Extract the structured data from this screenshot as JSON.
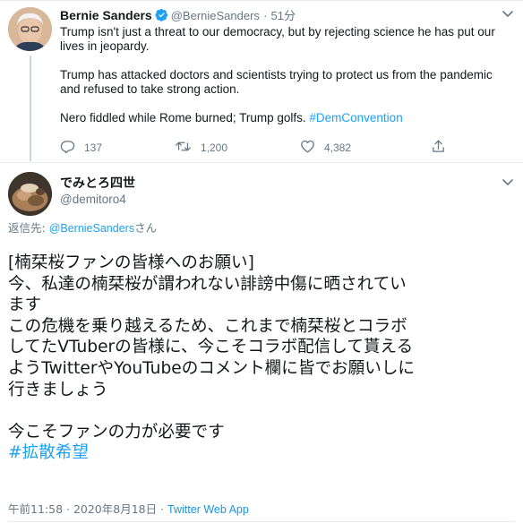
{
  "quoted": {
    "name": "Bernie Sanders",
    "handle": "@BernieSanders",
    "separator": "·",
    "time": "51分",
    "paragraphs": [
      "Trump isn't just a threat to our democracy, but by rejecting science he has put our lives in jeopardy.",
      "Trump has attacked doctors and scientists trying to protect us from the pandemic and refused to take strong action."
    ],
    "last_line_text": "Nero fiddled while Rome burned; Trump golfs. ",
    "hashtag": "#DemConvention",
    "replies": "137",
    "retweets": "1,200",
    "likes": "4,382"
  },
  "tweet": {
    "name": "でみとろ四世",
    "handle": "@demitoro4",
    "reply_prefix": "返信先: ",
    "reply_mention": "@BernieSanders",
    "reply_suffix": "さん",
    "lines": [
      "[楠栞桜ファンの皆様へのお願い]",
      "今、私達の楠栞桜が謂われない誹謗中傷に晒されてい",
      "ます",
      "この危機を乗り越えるため、これまで楠栞桜とコラボ",
      "してたVTuberの皆様に、今こそコラボ配信して貰える",
      "ようTwitterやYouTubeのコメント欄に皆でお願いしに",
      "行きましょう",
      "",
      "今こそファンの力が必要です"
    ],
    "tag": "#拡散希望",
    "timestamp": "午前11:58 · 2020年8月18日 · ",
    "app": "Twitter Web App"
  },
  "colors": {
    "accent": "#1da1f2",
    "muted": "#657786",
    "text": "#14171a"
  }
}
